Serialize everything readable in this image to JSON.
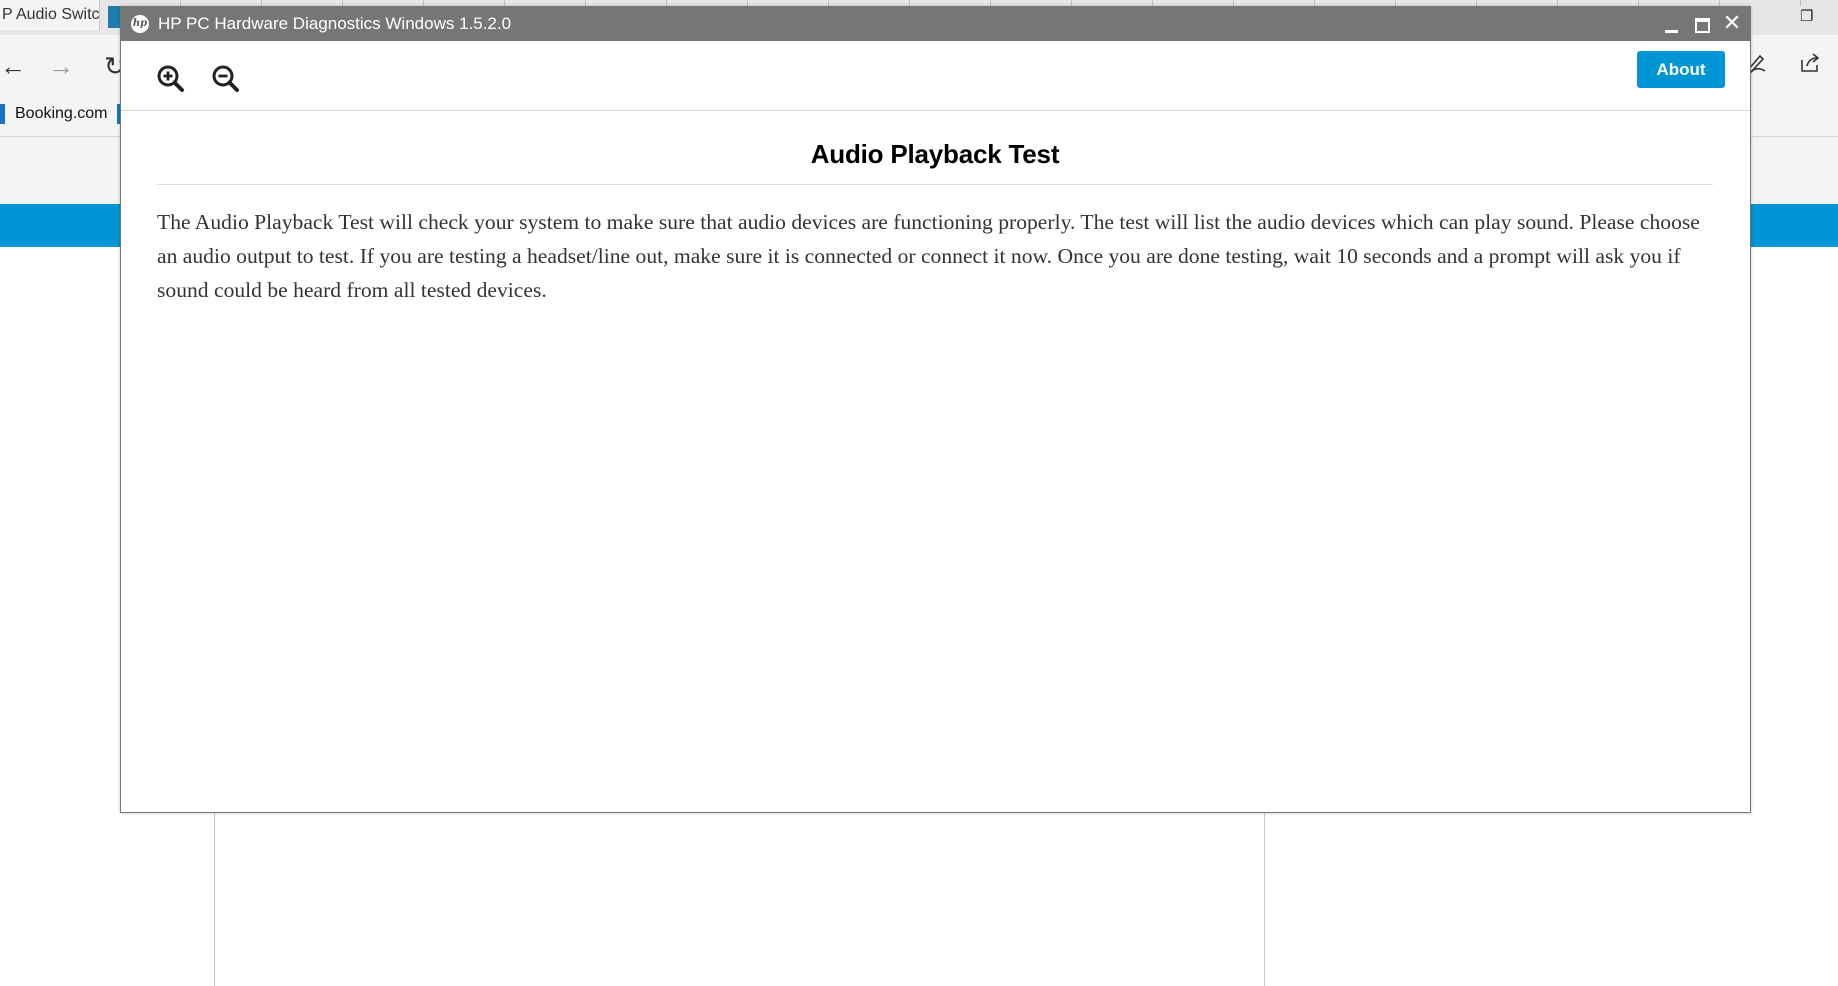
{
  "browser": {
    "tab_label": "P Audio Switch",
    "favorites": {
      "booking": "Booking.com"
    },
    "icons": {
      "back": "back-arrow-icon",
      "forward": "forward-arrow-icon",
      "refresh": "refresh-icon",
      "pen": "pen-icon",
      "share": "share-icon",
      "restore": "restore-window-icon"
    }
  },
  "dialog": {
    "title": "HP PC Hardware Diagnostics Windows 1.5.2.0",
    "logo_text": "hp",
    "toolbar": {
      "zoom_in": "zoom-in-icon",
      "zoom_out": "zoom-out-icon",
      "about_label": "About"
    },
    "heading": "Audio Playback Test",
    "description": "The Audio Playback Test will check your system to make sure that audio devices are functioning properly. The test will list the audio devices which can play sound. Please choose an audio output to test. If you are testing a headset/line out, make sure it is connected or connect it now. Once you are done testing, wait 10 seconds and a prompt will ask you if sound could be heard from all tested devices."
  },
  "colors": {
    "titlebar": "#767676",
    "accent": "#0096d6",
    "body_text": "#333333"
  }
}
